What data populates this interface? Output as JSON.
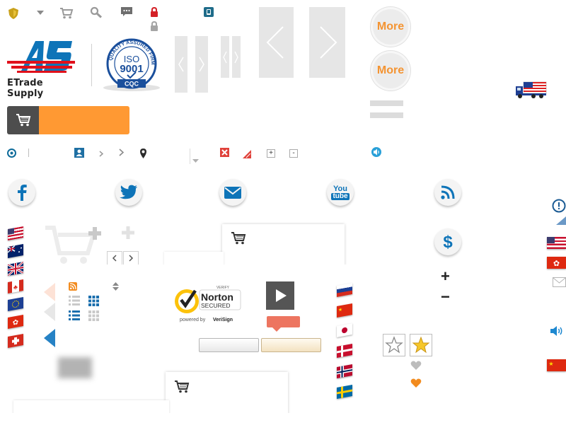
{
  "logo": {
    "company": "ETrade Supply",
    "initials": "AS"
  },
  "iso_badge": {
    "title": "ISO",
    "number": "9001",
    "arc_text": "QUALITY ASSURED FIRM",
    "footer": "CQC"
  },
  "more_buttons": [
    "More",
    "More"
  ],
  "norton": {
    "verify": "VERIFY",
    "brand": "Norton",
    "secured": "SECURED",
    "powered_prefix": "powered by",
    "powered_brand": "VeriSign"
  },
  "social": [
    "facebook-icon",
    "twitter-icon",
    "email-icon",
    "youtube-icon",
    "rss-icon"
  ],
  "youtube": {
    "you": "You",
    "tube": "tube"
  },
  "colors": {
    "orange": "#ff9933",
    "dark": "#4d4d4d",
    "blue": "#0e74b8",
    "red": "#e0101b"
  },
  "zoom": {
    "plus": "+",
    "minus": "−"
  },
  "small_buttons": {
    "plus": "+",
    "minus": "-"
  }
}
